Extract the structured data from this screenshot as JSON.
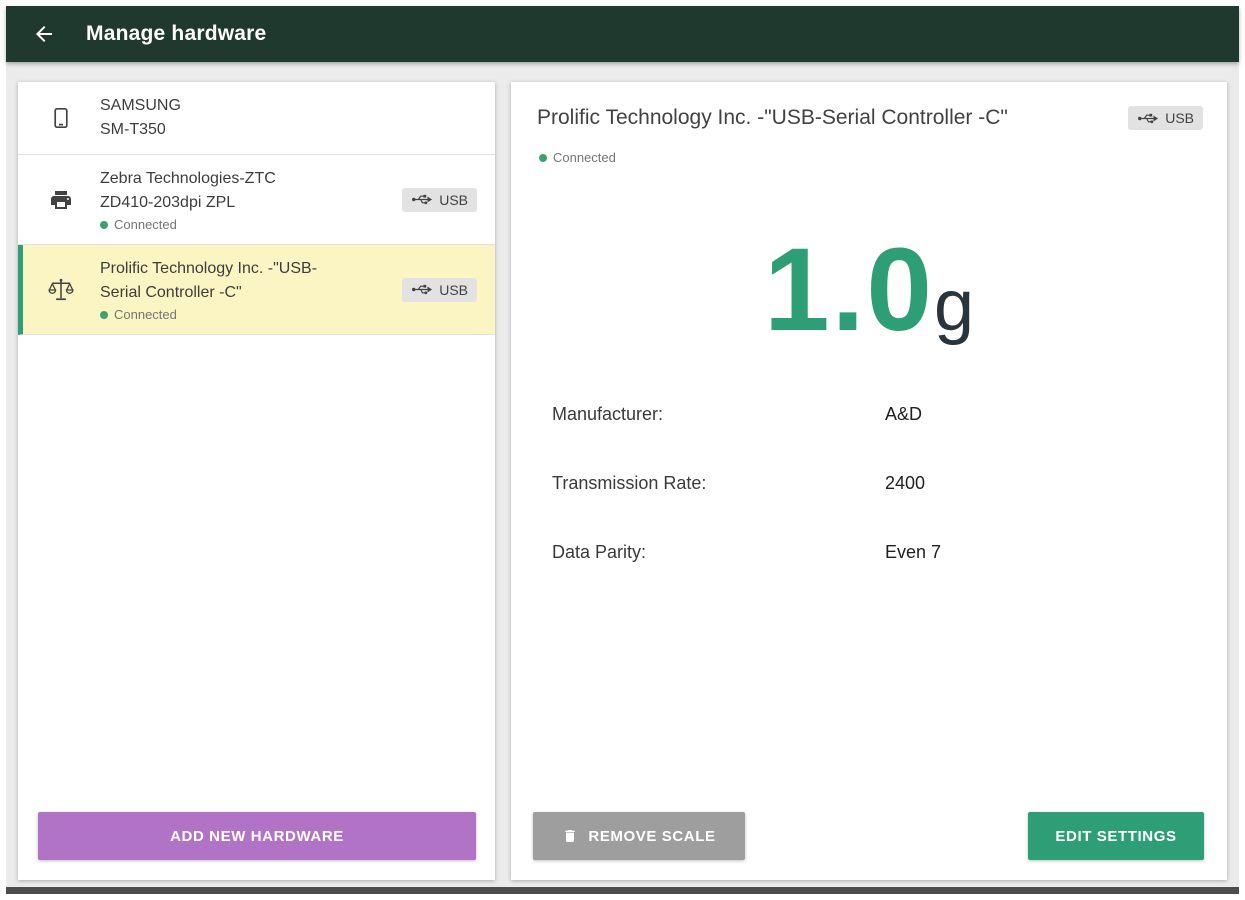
{
  "colors": {
    "appbar": "#20392f",
    "bg": "#ebebeb",
    "card": "#ffffff",
    "accent": "#2e9e76",
    "purple": "#b173c5",
    "graybtn": "#9e9e9e",
    "highlight": "#fbf5c3",
    "dot": "#3da06f",
    "badge-bg": "#e2e2e2",
    "text-primary": "#3d3d3d",
    "text-secondary": "#757575",
    "unit": "#28343e"
  },
  "app_bar": {
    "title": "Manage hardware"
  },
  "device_list": {
    "items": [
      {
        "line1": "SAMSUNG",
        "line2": "SM-T350",
        "icon": "tablet-icon",
        "status": "",
        "badge": ""
      },
      {
        "line1": "Zebra Technologies-ZTC",
        "line2": "ZD410-203dpi ZPL",
        "icon": "printer-icon",
        "status": "Connected",
        "badge": "USB"
      },
      {
        "line1": "Prolific Technology Inc. -\"USB-",
        "line2": "Serial Controller -C\"",
        "icon": "scale-icon",
        "status": "Connected",
        "badge": "USB",
        "selected": true
      }
    ],
    "add_button_label": "ADD NEW HARDWARE"
  },
  "details": {
    "title": "Prolific Technology Inc. -\"USB-Serial Controller -C\"",
    "badge": "USB",
    "status": "Connected",
    "reading_value": "1.0",
    "reading_unit": "g",
    "fields": [
      {
        "label": "Manufacturer:",
        "value": "A&D"
      },
      {
        "label": "Transmission Rate:",
        "value": "2400"
      },
      {
        "label": "Data Parity:",
        "value": "Even 7"
      }
    ],
    "remove_button_label": "REMOVE SCALE",
    "edit_button_label": "EDIT SETTINGS"
  }
}
